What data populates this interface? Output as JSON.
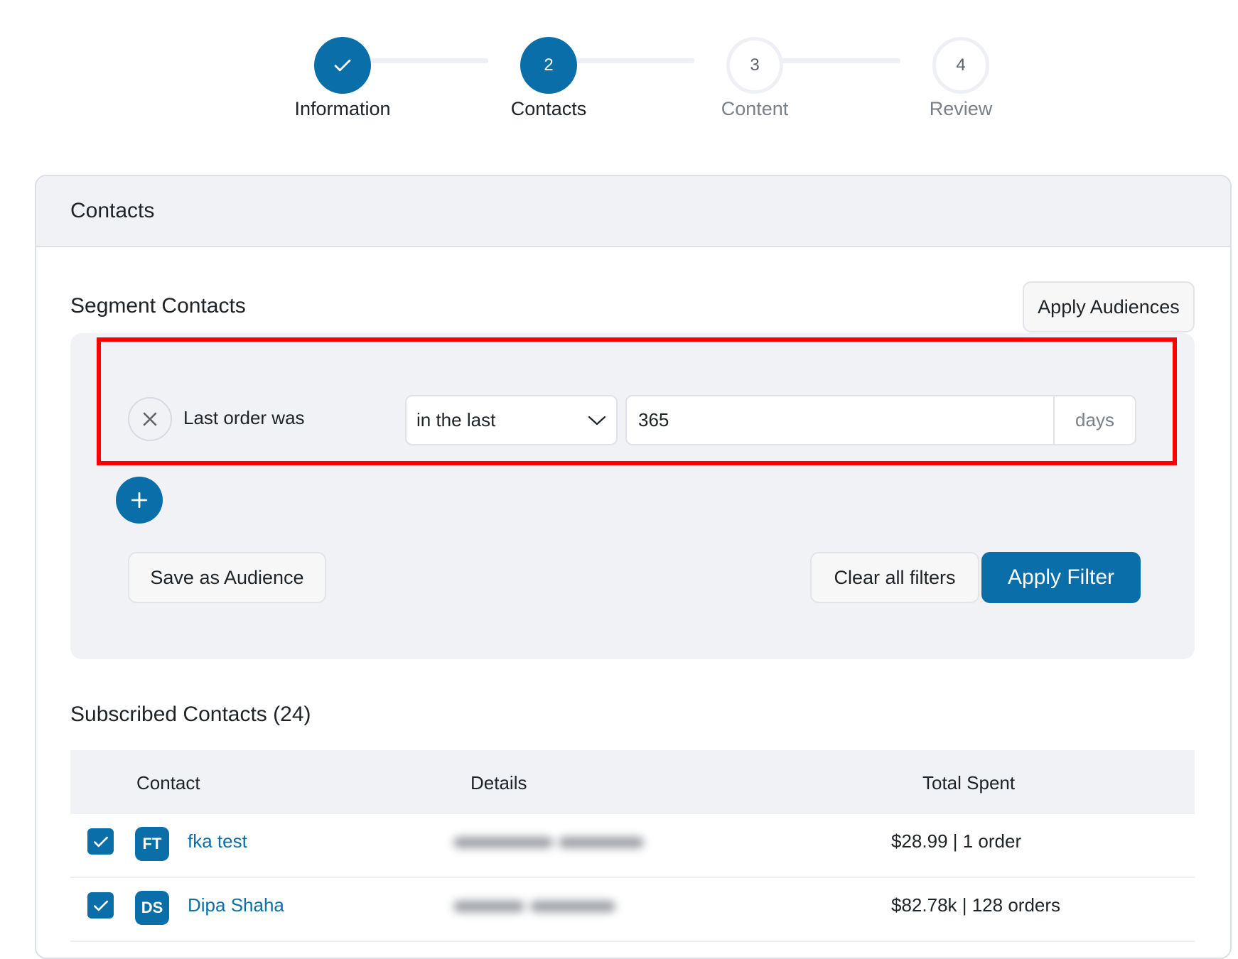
{
  "stepper": {
    "steps": [
      {
        "number": "",
        "label": "Information",
        "state": "completed",
        "icon": "check-icon"
      },
      {
        "number": "2",
        "label": "Contacts",
        "state": "active"
      },
      {
        "number": "3",
        "label": "Content",
        "state": "inactive"
      },
      {
        "number": "4",
        "label": "Review",
        "state": "inactive"
      }
    ]
  },
  "card": {
    "title": "Contacts",
    "segment": {
      "title": "Segment Contacts",
      "apply_audiences_label": "Apply Audiences",
      "filter": {
        "label": "Last order was",
        "operator": "in the last",
        "value": "365",
        "unit": "days",
        "remove_icon": "close-icon",
        "chevron_icon": "chevron-down-icon"
      },
      "add_filter_icon": "plus-icon",
      "save_as_audience_label": "Save as Audience",
      "clear_all_filters_label": "Clear all filters",
      "apply_filter_label": "Apply Filter"
    },
    "subscribed": {
      "title": "Subscribed Contacts (24)",
      "columns": [
        "Contact",
        "Details",
        "Total Spent"
      ],
      "rows": [
        {
          "initials": "FT",
          "name": "fka test",
          "total_spent": "$28.99 | 1 order",
          "checked": true
        },
        {
          "initials": "DS",
          "name": "Dipa Shaha",
          "total_spent": "$82.78k | 128 orders",
          "checked": true
        }
      ]
    }
  },
  "colors": {
    "primary": "#0a6ea8",
    "highlight": "#ff0000",
    "panel_bg": "#f1f2f6"
  }
}
